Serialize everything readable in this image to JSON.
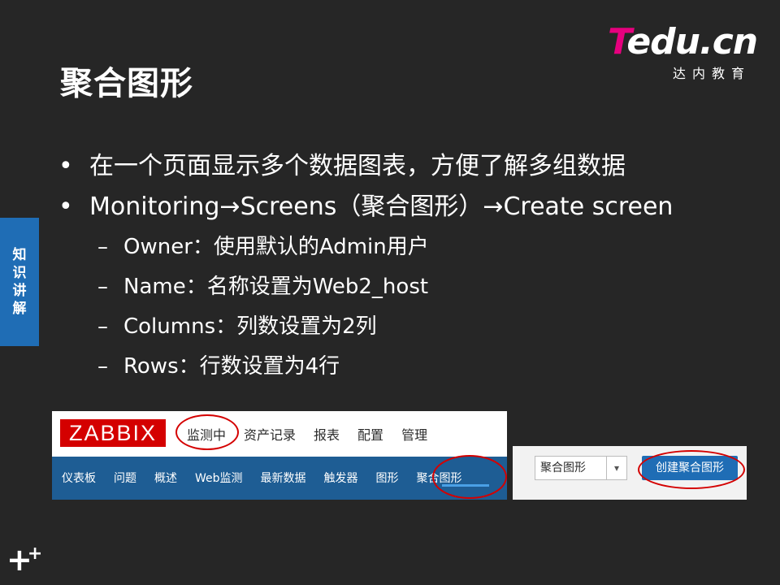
{
  "slide": {
    "title": "聚合图形",
    "logo_brand_t": "T",
    "logo_brand_rest": "edu.cn",
    "logo_sub": "达内教育",
    "side_tab": [
      "知",
      "识",
      "讲",
      "解"
    ],
    "bullets": [
      {
        "text": "在一个页面显示多个数据图表，方便了解多组数据"
      },
      {
        "text": "Monitoring→Screens（聚合图形）→Create screen"
      }
    ],
    "sub_bullets": [
      "Owner：使用默认的Admin用户",
      "Name：名称设置为Web2_host",
      "Columns：列数设置为2列",
      "Rows：行数设置为4行"
    ],
    "bullet_symbol": "•",
    "dash_symbol": "–"
  },
  "zabbix_screenshot": {
    "logo": "ZABBIX",
    "top_menu": [
      "监测中",
      "资产记录",
      "报表",
      "配置",
      "管理"
    ],
    "sub_menu": [
      "仪表板",
      "问题",
      "概述",
      "Web监测",
      "最新数据",
      "触发器",
      "图形",
      "聚合图形"
    ]
  },
  "screens_toolbar": {
    "select_value": "聚合图形",
    "create_button": "创建聚合图形"
  },
  "colors": {
    "background": "#262626",
    "accent_blue": "#1f6db5",
    "zabbix_red": "#d40000",
    "zabbix_nav": "#1e5d94",
    "annotation_red": "#d40000"
  }
}
